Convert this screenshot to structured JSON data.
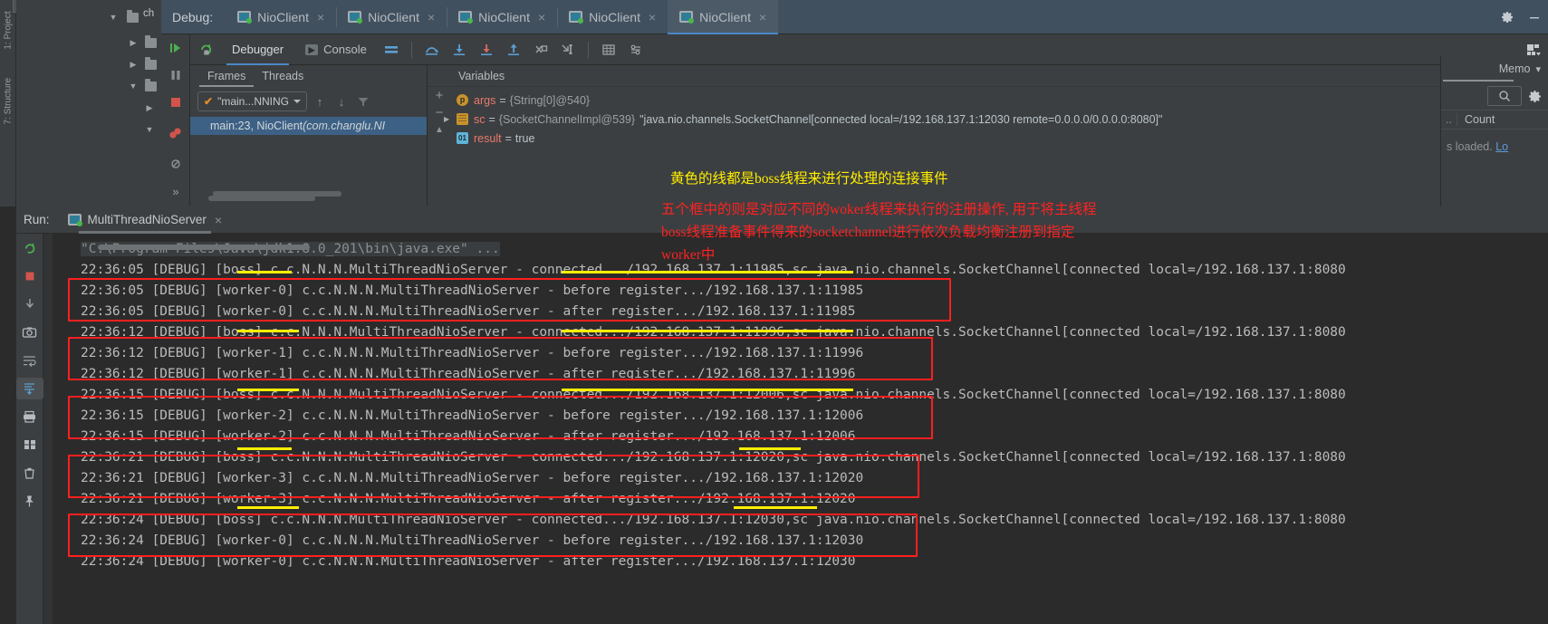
{
  "left_gutter": {
    "vertical_labels": [
      "1: Project",
      "7: Structure"
    ],
    "project_tab_label": "Project"
  },
  "debug_window": {
    "label": "Debug:",
    "tabs": [
      {
        "label": "NioClient",
        "icon": "run-config-icon",
        "active": false
      },
      {
        "label": "NioClient",
        "icon": "run-config-icon",
        "active": false
      },
      {
        "label": "NioClient",
        "icon": "run-config-icon",
        "active": false
      },
      {
        "label": "NioClient",
        "icon": "run-config-icon",
        "active": false
      },
      {
        "label": "NioClient",
        "icon": "run-config-icon",
        "active": true
      }
    ],
    "title_buttons": [
      "gear-icon",
      "minimize-icon"
    ],
    "toolbar": {
      "rerun": "rerun-icon",
      "tabs": [
        {
          "label": "Debugger",
          "selected": true
        },
        {
          "label": "Console",
          "selected": false
        }
      ],
      "buttons": [
        "layout-icon",
        "step-over-icon",
        "step-into-icon",
        "force-step-into-icon",
        "step-out-icon",
        "drop-frame-icon",
        "run-to-cursor-icon",
        "evaluate-icon",
        "settings-icon"
      ]
    },
    "rail_buttons": [
      "resume-icon",
      "pause-icon",
      "stop-icon",
      "view-breakpoints-icon",
      "mute-breakpoints-icon",
      "more-icon"
    ]
  },
  "frames_pane": {
    "tabs": [
      {
        "label": "Frames",
        "selected": true
      },
      {
        "label": "Threads",
        "selected": false
      }
    ],
    "thread_selector": "\"main...NNING",
    "thread_check": "✔",
    "nav_up": "↑",
    "nav_down": "↓",
    "filter_icon": "filter-icon",
    "frames": [
      {
        "text": "main:23, NioClient ",
        "italic": "(com.changlu.NI",
        "selected": true
      }
    ]
  },
  "variables_pane": {
    "header": "Variables",
    "gutter_buttons": [
      "+",
      "−",
      "▲"
    ],
    "rows": [
      {
        "expandable": false,
        "icon": "param-icon",
        "icon_letter": "p",
        "name": "args",
        "eq": "=",
        "ref": "{String[0]@540}",
        "value": ""
      },
      {
        "expandable": true,
        "icon": "object-icon",
        "icon_letter": "",
        "name": "sc",
        "eq": "=",
        "ref": "{SocketChannelImpl@539}",
        "value": "\"java.nio.channels.SocketChannel[connected local=/192.168.137.1:12030 remote=0.0.0.0/0.0.0.0:8080]\""
      },
      {
        "expandable": false,
        "icon": "boolean-icon",
        "icon_letter": "01",
        "name": "result",
        "eq": "=",
        "ref": "",
        "value": "true"
      }
    ]
  },
  "memory_pane": {
    "tab_label": "Memo",
    "chevron": "chevron-down-icon",
    "search_icon": "search-icon",
    "gear_icon": "gear-icon",
    "columns": [
      "..",
      "Count"
    ],
    "status_text": "s loaded.",
    "status_link": "Lo"
  },
  "run_window": {
    "label": "Run:",
    "tab": {
      "label": "MultiThreadNioServer",
      "icon": "run-config-icon",
      "close": "×"
    },
    "rail_buttons": [
      "rerun-icon",
      "stop-icon",
      "trace-icon",
      "camera-icon",
      "wrap-icon",
      "scroll-end-icon",
      "print-icon",
      "clear-icon",
      "grid-icon",
      "delete-icon",
      "pin-icon"
    ]
  },
  "console": {
    "lines": [
      {
        "type": "cmd",
        "text": "\"C:\\Program Files\\Java\\jdk1.8.0_201\\bin\\java.exe\" ..."
      },
      {
        "type": "log",
        "text": "22:36:05 [DEBUG] [boss] c.c.N.N.N.MultiThreadNioServer - connected.../192.168.137.1:11985,sc java.nio.channels.SocketChannel[connected local=/192.168.137.1:8080"
      },
      {
        "type": "log",
        "text": "22:36:05 [DEBUG] [worker-0] c.c.N.N.N.MultiThreadNioServer - before register.../192.168.137.1:11985"
      },
      {
        "type": "log",
        "text": "22:36:05 [DEBUG] [worker-0] c.c.N.N.N.MultiThreadNioServer - after register.../192.168.137.1:11985"
      },
      {
        "type": "log",
        "text": "22:36:12 [DEBUG] [boss] c.c.N.N.N.MultiThreadNioServer - connected.../192.168.137.1:11996,sc java.nio.channels.SocketChannel[connected local=/192.168.137.1:8080"
      },
      {
        "type": "log",
        "text": "22:36:12 [DEBUG] [worker-1] c.c.N.N.N.MultiThreadNioServer - before register.../192.168.137.1:11996"
      },
      {
        "type": "log",
        "text": "22:36:12 [DEBUG] [worker-1] c.c.N.N.N.MultiThreadNioServer - after register.../192.168.137.1:11996"
      },
      {
        "type": "log",
        "text": "22:36:15 [DEBUG] [boss] c.c.N.N.N.MultiThreadNioServer - connected.../192.168.137.1:12006,sc java.nio.channels.SocketChannel[connected local=/192.168.137.1:8080"
      },
      {
        "type": "log",
        "text": "22:36:15 [DEBUG] [worker-2] c.c.N.N.N.MultiThreadNioServer - before register.../192.168.137.1:12006"
      },
      {
        "type": "log",
        "text": "22:36:15 [DEBUG] [worker-2] c.c.N.N.N.MultiThreadNioServer - after register.../192.168.137.1:12006"
      },
      {
        "type": "log",
        "text": "22:36:21 [DEBUG] [boss] c.c.N.N.N.MultiThreadNioServer - connected.../192.168.137.1:12020,sc java.nio.channels.SocketChannel[connected local=/192.168.137.1:8080"
      },
      {
        "type": "log",
        "text": "22:36:21 [DEBUG] [worker-3] c.c.N.N.N.MultiThreadNioServer - before register.../192.168.137.1:12020"
      },
      {
        "type": "log",
        "text": "22:36:21 [DEBUG] [worker-3] c.c.N.N.N.MultiThreadNioServer - after register.../192.168.137.1:12020"
      },
      {
        "type": "log",
        "text": "22:36:24 [DEBUG] [boss] c.c.N.N.N.MultiThreadNioServer - connected.../192.168.137.1:12030,sc java.nio.channels.SocketChannel[connected local=/192.168.137.1:8080"
      },
      {
        "type": "log",
        "text": "22:36:24 [DEBUG] [worker-0] c.c.N.N.N.MultiThreadNioServer - before register.../192.168.137.1:12030"
      },
      {
        "type": "log",
        "text": "22:36:24 [DEBUG] [worker-0] c.c.N.N.N.MultiThreadNioServer - after register.../192.168.137.1:12030"
      }
    ]
  },
  "annotations": {
    "yellow_note": "黄色的线都是boss线程来进行处理的连接事件",
    "red_note_lines": [
      "五个框中的则是对应不同的woker线程来执行的注册操作, 用于将主线程",
      "boss线程准备事件得来的socketchannel进行依次负载均衡注册到指定",
      "worker中"
    ],
    "colors": {
      "yellow": "#ffee00",
      "red": "#ff2222",
      "box_red": "#ff1f1f"
    }
  }
}
